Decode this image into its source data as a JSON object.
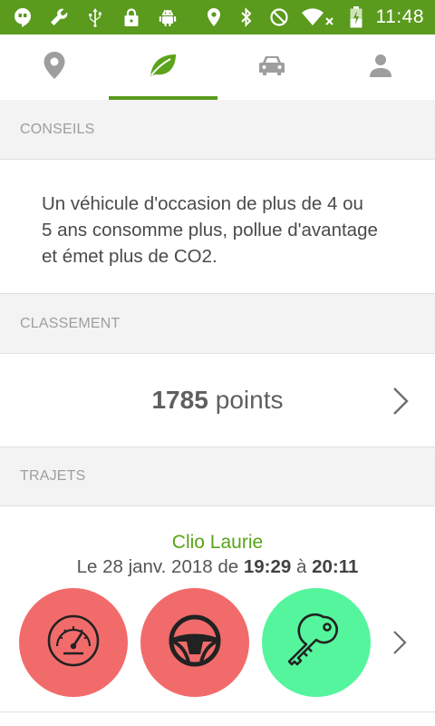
{
  "status_bar": {
    "time": "11:48",
    "left_icons": [
      "hangouts-icon",
      "wrench-icon",
      "usb-icon",
      "lock-icon",
      "android-icon"
    ],
    "right_icons": [
      "location-icon",
      "bluetooth-icon",
      "do-not-disturb-icon",
      "wifi-icon",
      "battery-charging-icon"
    ]
  },
  "tabs": [
    {
      "name": "location",
      "icon": "location-pin-icon",
      "active": false
    },
    {
      "name": "eco",
      "icon": "leaf-icon",
      "active": true
    },
    {
      "name": "vehicle",
      "icon": "car-icon",
      "active": false
    },
    {
      "name": "profile",
      "icon": "person-icon",
      "active": false
    }
  ],
  "colors": {
    "brand_green": "#5a9a1d",
    "circle_red": "#f26b6b",
    "circle_green": "#55f59d"
  },
  "sections": {
    "conseils": {
      "header": "CONSEILS",
      "text_lines": [
        "Un véhicule d'occasion de plus de 4 ou",
        "5 ans consomme plus, pollue d'avantage",
        "et émet plus de CO2."
      ]
    },
    "classement": {
      "header": "CLASSEMENT",
      "points_value": "1785",
      "points_unit": "points"
    },
    "trajets": {
      "header": "TRAJETS",
      "trip": {
        "name": "Clio Laurie",
        "date_prefix": "Le 28 janv. 2018 de",
        "start_time": "19:29",
        "connector": "à",
        "end_time": "20:11",
        "indicators": [
          {
            "icon": "speedometer-icon",
            "status": "red"
          },
          {
            "icon": "steering-wheel-icon",
            "status": "red"
          },
          {
            "icon": "key-icon",
            "status": "green"
          }
        ]
      }
    }
  }
}
